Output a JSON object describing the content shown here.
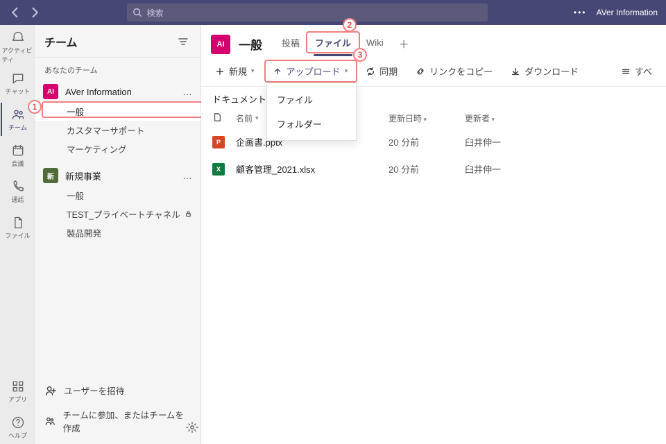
{
  "top": {
    "search_placeholder": "検索",
    "user_label": "AVer Information"
  },
  "rail": [
    {
      "label": "アクティビティ",
      "name": "activity"
    },
    {
      "label": "チャット",
      "name": "chat"
    },
    {
      "label": "チーム",
      "name": "teams",
      "active": true
    },
    {
      "label": "会議",
      "name": "calendar"
    },
    {
      "label": "通話",
      "name": "calls"
    },
    {
      "label": "ファイル",
      "name": "files"
    }
  ],
  "rail_bottom": [
    {
      "label": "アプリ",
      "name": "apps"
    },
    {
      "label": "ヘルプ",
      "name": "help"
    }
  ],
  "sidebar": {
    "title": "チーム",
    "section": "あなたのチーム",
    "teams": [
      {
        "avatar": "AI",
        "color": "#d4006d",
        "name": "AVer Information",
        "channels": [
          {
            "name": "一般",
            "selected": true
          },
          {
            "name": "カスタマーサポート"
          },
          {
            "name": "マーケティング"
          }
        ]
      },
      {
        "avatar": "新",
        "color": "#4f6b3a",
        "name": "新規事業",
        "channels": [
          {
            "name": "一般"
          },
          {
            "name": "TEST_プライベートチャネル",
            "private": true
          },
          {
            "name": "製品開発"
          }
        ]
      }
    ],
    "footer": {
      "invite": "ユーザーを招待",
      "join": "チームに参加、またはチームを作成"
    }
  },
  "content": {
    "channel": "一般",
    "tabs": [
      {
        "label": "投稿"
      },
      {
        "label": "ファイル",
        "active": true
      },
      {
        "label": "Wiki"
      }
    ],
    "toolbar": {
      "new": "新規",
      "upload": "アップロード",
      "sync": "同期",
      "copylink": "リンクをコピー",
      "download": "ダウンロード",
      "alldocs": "すべ"
    },
    "upload_menu": [
      "ファイル",
      "フォルダー"
    ],
    "breadcrumb": "ドキュメント",
    "columns": {
      "name": "名前",
      "modified": "更新日時",
      "modifiedby": "更新者"
    },
    "files": [
      {
        "icon": "pptx",
        "name": "企画書.pptx",
        "modified": "20 分前",
        "modifiedby": "臼井伸一"
      },
      {
        "icon": "xlsx",
        "name": "顧客管理_2021.xlsx",
        "modified": "20 分前",
        "modifiedby": "臼井伸一"
      }
    ]
  },
  "markers": {
    "one": "1",
    "two": "2",
    "three": "3"
  }
}
